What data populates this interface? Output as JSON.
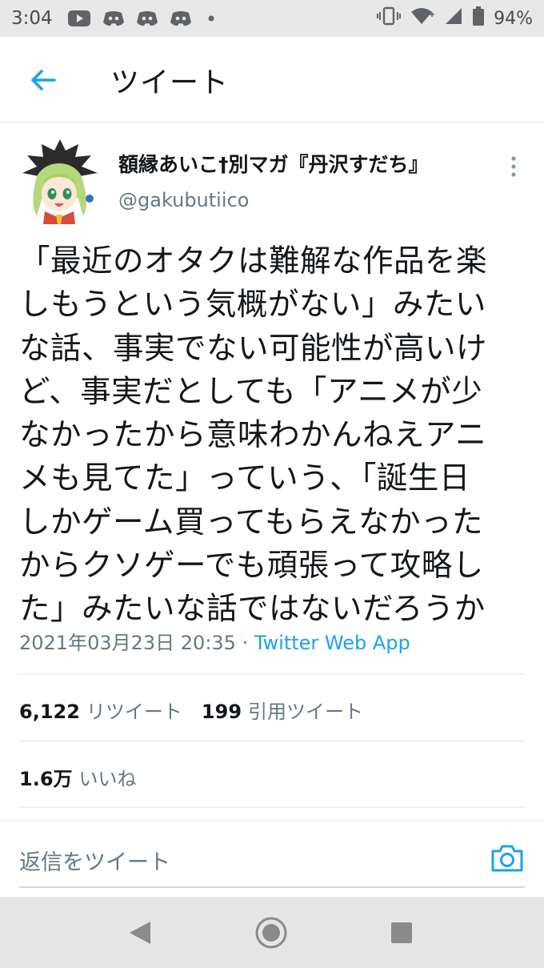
{
  "status_bar": {
    "time": "3:04",
    "battery_percent": "94%",
    "icons": [
      "youtube-icon",
      "discord-icon",
      "discord-icon",
      "discord-icon",
      "dot-icon",
      "vibrate-icon",
      "wifi-icon",
      "signal-icon",
      "battery-icon"
    ]
  },
  "header": {
    "title": "ツイート",
    "back_icon": "arrow-left-icon"
  },
  "tweet": {
    "author": {
      "display_name": "額縁あいこ†別マガ『丹沢すだち』",
      "handle": "@gakubutiico"
    },
    "text_lines": [
      "「最近のオタクは難解な作品を楽",
      "しもうという気概がない」みたい",
      "な話、事実でない可能性が高いけ",
      "ど、事実だとしても「アニメが少",
      "なかったから意味わかんねえアニ",
      "メも見てた」っていう、「誕生日",
      "しかゲーム買ってもらえなかった",
      "からクソゲーでも頑張って攻略し",
      "た」みたいな話ではないだろうか"
    ],
    "timestamp": "2021年03月23日 20:35",
    "separator": " · ",
    "source": "Twitter Web App",
    "stats": {
      "retweets": "6,122",
      "retweets_label": "リツイート",
      "quotes": "199",
      "quotes_label": "引用ツイート",
      "likes": "1.6万",
      "likes_label": "いいね"
    }
  },
  "reply": {
    "placeholder": "返信をツイート"
  },
  "colors": {
    "accent": "#1da1f2",
    "secondary_text": "#657786",
    "primary_text": "#14171a",
    "divider": "#e1e8ed"
  }
}
